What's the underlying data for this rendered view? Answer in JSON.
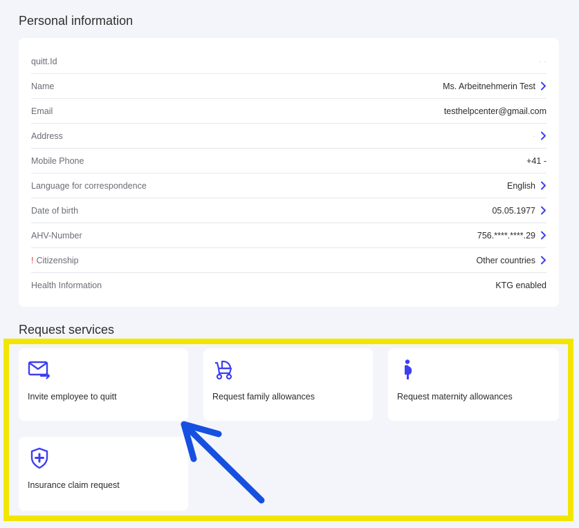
{
  "personal": {
    "title": "Personal information",
    "rows": [
      {
        "label": "quitt.Id",
        "value": "· ·",
        "chevron": false,
        "warn": false
      },
      {
        "label": "Name",
        "value": "Ms. Arbeitnehmerin Test",
        "chevron": true,
        "warn": false
      },
      {
        "label": "Email",
        "value": "testhelpcenter@gmail.com",
        "chevron": false,
        "warn": false
      },
      {
        "label": "Address",
        "value": "·",
        "chevron": true,
        "warn": false
      },
      {
        "label": "Mobile Phone",
        "value": "+41 -",
        "chevron": false,
        "warn": false
      },
      {
        "label": "Language for correspondence",
        "value": "English",
        "chevron": true,
        "warn": false
      },
      {
        "label": "Date of birth",
        "value": "05.05.1977",
        "chevron": true,
        "warn": false
      },
      {
        "label": "AHV-Number",
        "value": "756.****.****.29",
        "chevron": true,
        "warn": false
      },
      {
        "label": "Citizenship",
        "value": "Other countries",
        "chevron": true,
        "warn": true,
        "warn_mark": "!"
      },
      {
        "label": "Health Information",
        "value": "KTG enabled",
        "chevron": false,
        "warn": false
      }
    ]
  },
  "services": {
    "title": "Request services",
    "items": [
      {
        "label": "Invite employee to quitt",
        "icon": "mail-forward-icon"
      },
      {
        "label": "Request family allowances",
        "icon": "stroller-icon"
      },
      {
        "label": "Request maternity allowances",
        "icon": "pregnant-icon"
      },
      {
        "label": "Insurance claim request",
        "icon": "shield-plus-icon"
      }
    ]
  },
  "colors": {
    "accent": "#3d3ff0",
    "highlight": "#f2e600",
    "annotation_arrow": "#1550e0",
    "warning": "#e53935"
  }
}
